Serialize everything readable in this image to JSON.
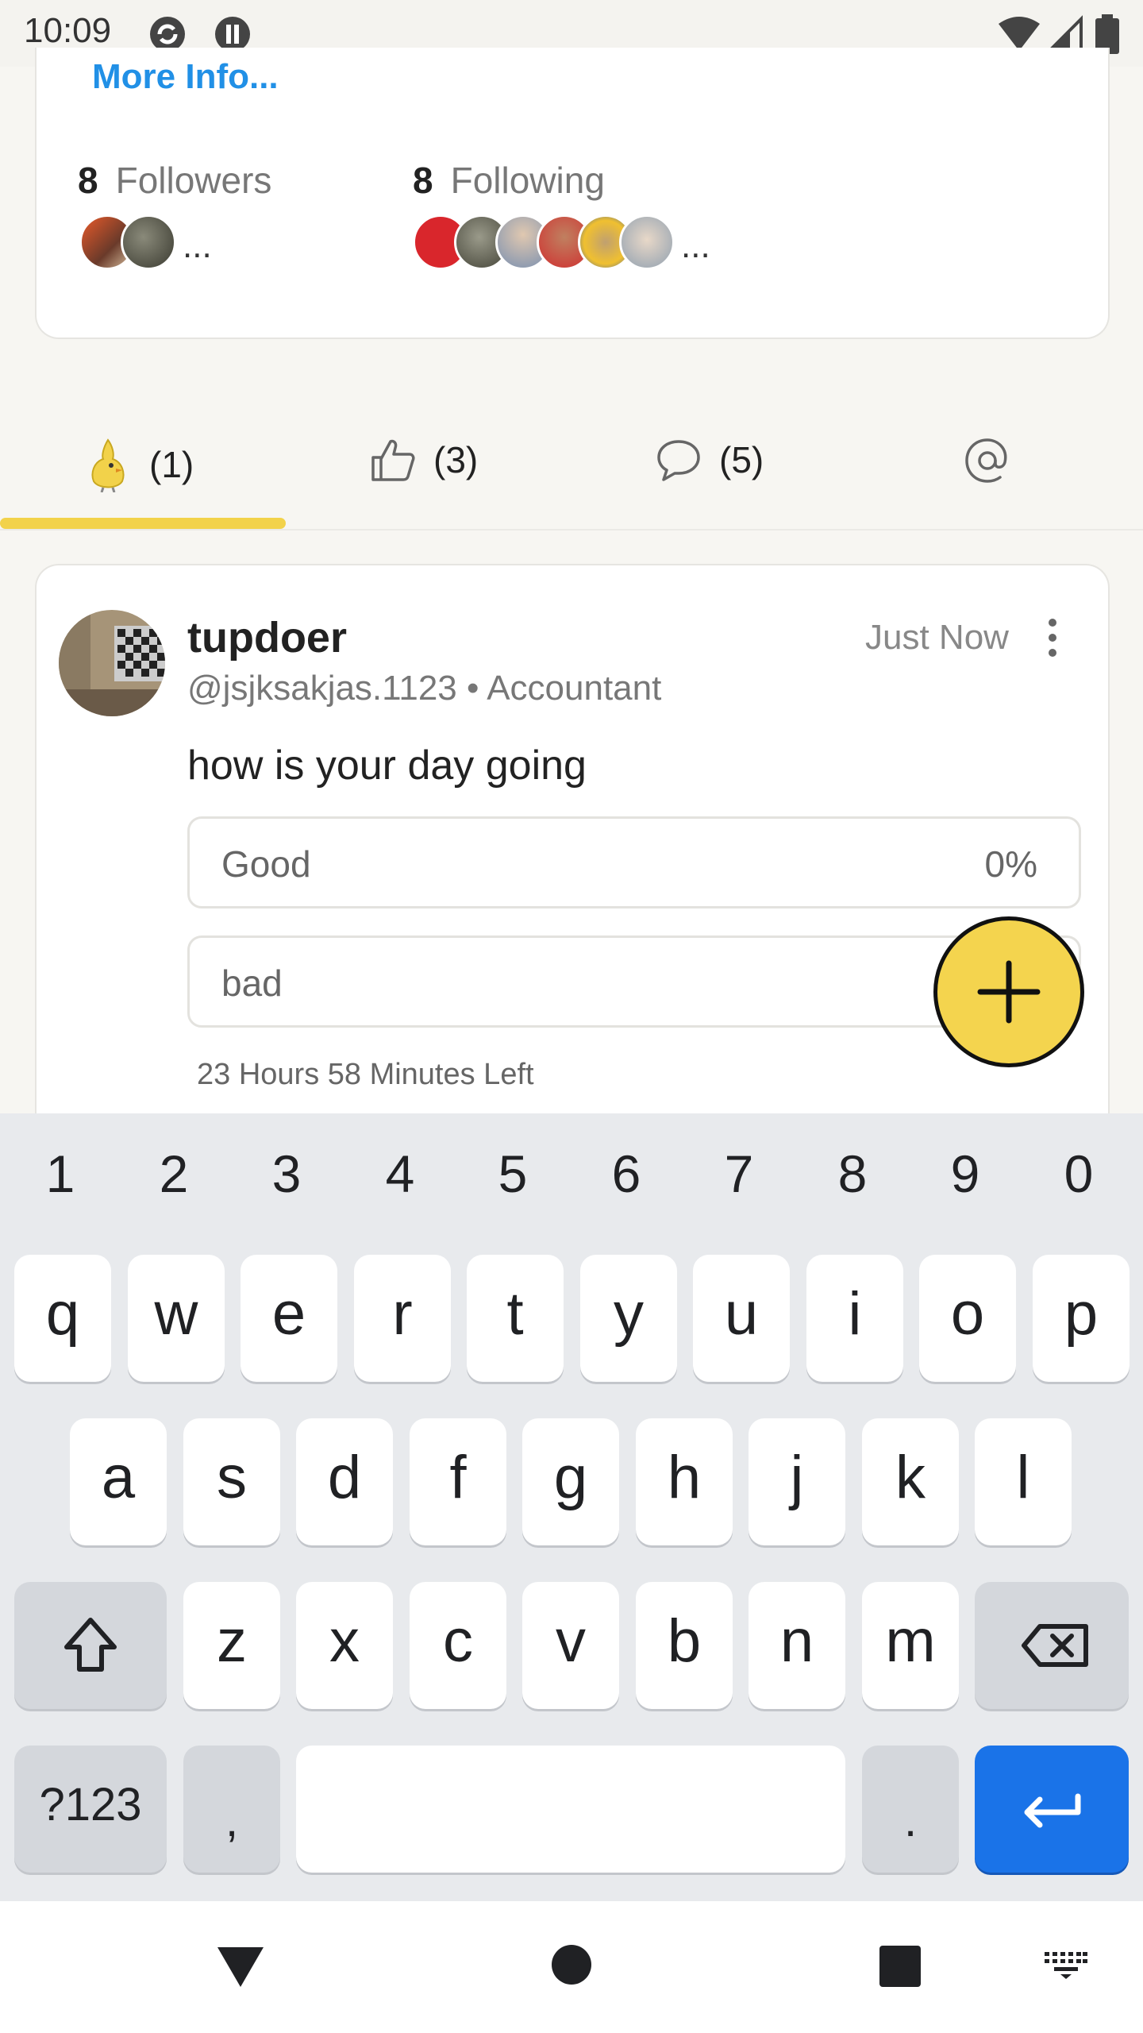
{
  "status_bar": {
    "time": "10:09"
  },
  "profile": {
    "more_info": "More Info...",
    "followers": {
      "count": "8",
      "label": "Followers",
      "more": "..."
    },
    "following": {
      "count": "8",
      "label": "Following",
      "more": "..."
    }
  },
  "tabs": [
    {
      "icon": "koo-bird-icon",
      "count": "(1)"
    },
    {
      "icon": "thumbs-up-icon",
      "count": "(3)"
    },
    {
      "icon": "comment-icon",
      "count": "(5)"
    },
    {
      "icon": "at-icon",
      "count": ""
    }
  ],
  "post": {
    "username": "tupdoer",
    "handle": "@jsjksakjas.1123 • Accountant",
    "time": "Just Now",
    "question": "how is your day going",
    "options": [
      {
        "label": "Good",
        "percent": "0%"
      },
      {
        "label": "bad",
        "percent": ""
      }
    ],
    "time_left": "23 Hours 58 Minutes Left"
  },
  "keyboard": {
    "numbers": [
      "1",
      "2",
      "3",
      "4",
      "5",
      "6",
      "7",
      "8",
      "9",
      "0"
    ],
    "row1": [
      "q",
      "w",
      "e",
      "r",
      "t",
      "y",
      "u",
      "i",
      "o",
      "p"
    ],
    "row2": [
      "a",
      "s",
      "d",
      "f",
      "g",
      "h",
      "j",
      "k",
      "l"
    ],
    "row3": [
      "z",
      "x",
      "c",
      "v",
      "b",
      "n",
      "m"
    ],
    "symbols_label": "?123",
    "comma": ",",
    "period": "."
  },
  "colors": {
    "accent": "#f2d24a",
    "link": "#2190e6",
    "enter": "#1a73e8"
  }
}
